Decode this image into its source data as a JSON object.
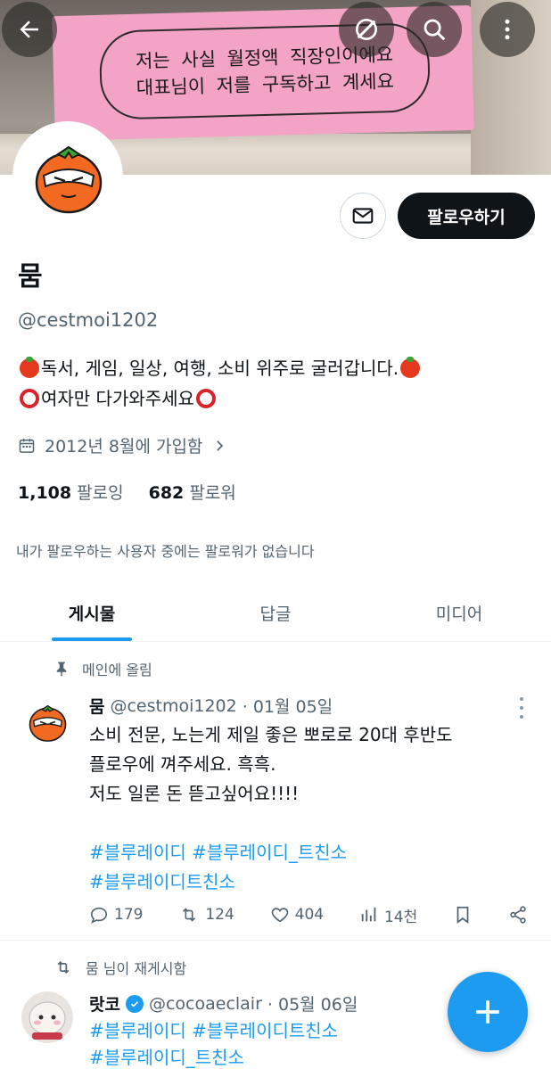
{
  "banner": {
    "sticker_line1": "저는 사실 월정액 직장인이에요",
    "sticker_line2": "대표님이 저를 구독하고 계세요"
  },
  "topbar": {
    "back_icon": "arrow-left-icon",
    "grok_icon": "grok-icon",
    "search_icon": "search-icon",
    "more_icon": "more-vertical-icon"
  },
  "profile": {
    "name": "뭄",
    "handle": "@cestmoi1202",
    "bio_line1": "독서, 게임, 일상, 여행, 소비 위주로 굴러갑니다.",
    "bio_line2": "여자만 다가와주세요",
    "joined": "2012년 8월에 가입함",
    "following_count": "1,108",
    "following_label": "팔로잉",
    "followers_count": "682",
    "followers_label": "팔로워",
    "no_mutual": "내가 팔로우하는 사용자 중에는 팔로워가 없습니다"
  },
  "actions": {
    "follow_label": "팔로우하기",
    "message_icon": "mail-icon"
  },
  "tabs": [
    {
      "label": "게시물",
      "active": true
    },
    {
      "label": "답글",
      "active": false
    },
    {
      "label": "미디어",
      "active": false
    }
  ],
  "pinned_tweet": {
    "context": "메인에 올림",
    "author": "뭄",
    "handle": "@cestmoi1202",
    "date": "· 01월 05일",
    "line1": "소비 전문, 노는게 제일 좋은 뽀로로 20대 후반도",
    "line2": "플로우에 껴주세요. 흑흑.",
    "line3": "저도 일론 돈 뜯고싶어요!!!!",
    "hashtag_line1": "#블루레이디 #블루레이디_트친소",
    "hashtag_line2": "#블루레이디트친소",
    "replies": "179",
    "retweets": "124",
    "likes": "404",
    "views": "14천"
  },
  "retweet": {
    "context": "뭄 님이 재게시함",
    "author": "랏코",
    "handle": "@cocoaeclair",
    "date": "· 05월 06일",
    "hashtag_line1": "#블루레이디 #블루레이디트친소",
    "hashtag_line2": "#블루레이디_트친소"
  },
  "colors": {
    "accent": "#1d9bf0",
    "text": "#0f1419",
    "secondary": "#536471"
  }
}
